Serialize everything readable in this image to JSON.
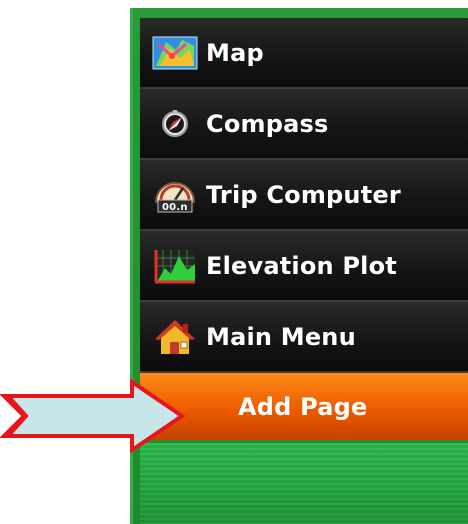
{
  "menu": {
    "items": [
      {
        "label": "Map",
        "icon": "map-icon"
      },
      {
        "label": "Compass",
        "icon": "compass-icon"
      },
      {
        "label": "Trip Computer",
        "icon": "trip-computer-icon"
      },
      {
        "label": "Elevation Plot",
        "icon": "elevation-plot-icon"
      },
      {
        "label": "Main Menu",
        "icon": "house-icon"
      }
    ],
    "selected_label": "Add Page"
  },
  "colors": {
    "selected": "#ec5a00",
    "frame": "#2a9a3a",
    "arrow_fill": "#c6e6ea",
    "arrow_stroke": "#e8141c"
  }
}
